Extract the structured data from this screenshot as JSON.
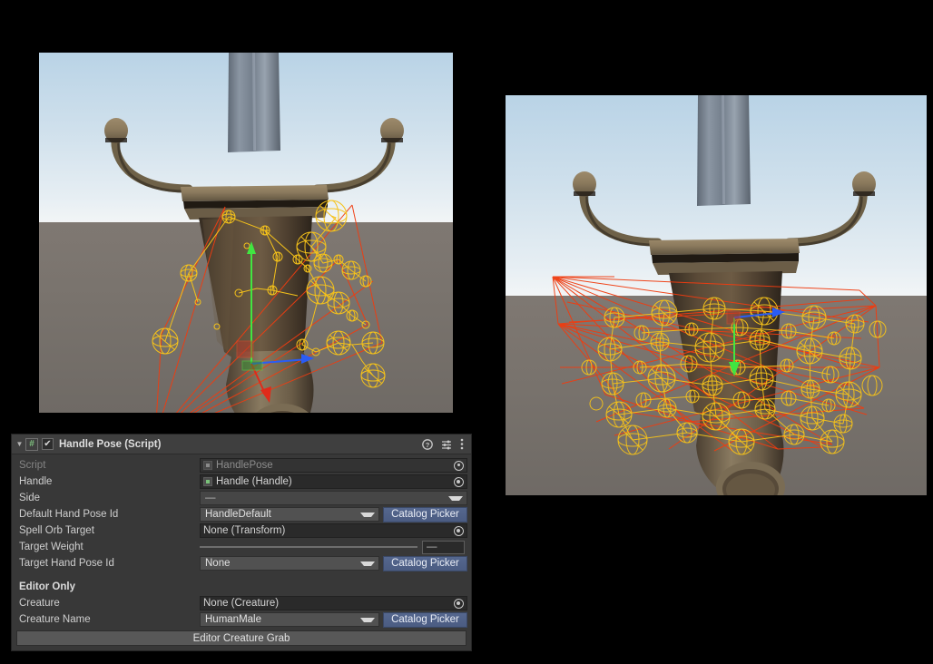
{
  "app": {
    "editor": "Unity Editor",
    "background_color": "#000000"
  },
  "viewports": [
    {
      "name": "scene-view-left",
      "description": "3D scene view of a sword handle with yellow wireframe hand-pose gizmo spheres and red selection lines",
      "sky_color": "#cfe0ec",
      "ground_color": "#79736d",
      "gizmo_colors": {
        "pose_sphere": "#f5c21a",
        "selection_line": "#f03c10",
        "axis_y": "#41e541",
        "axis_x": "#2a5cf5",
        "axis_z": "#e02a1a"
      }
    },
    {
      "name": "scene-view-right",
      "description": "3D scene view of the same sword handle with a dense cluster of yellow hand-pose wireframe spheres",
      "sky_color": "#cfe0ec",
      "ground_color": "#79736d",
      "gizmo_colors": {
        "pose_sphere": "#f5c21a",
        "selection_line": "#f03c10",
        "axis_y": "#41e541"
      }
    }
  ],
  "inspector": {
    "header": {
      "title": "Handle Pose (Script)",
      "foldout_glyph": "▼",
      "script_icon": "#",
      "enabled_checkbox": "✔",
      "help_icon": "help-icon",
      "preset_icon": "preset-icon",
      "menu_icon": "kebab-menu-icon"
    },
    "accent_colors": {
      "button_blue": "#4b5c82",
      "panel_bg": "#383838",
      "field_bg": "#2a2a2a",
      "dropdown_bg": "#515151"
    },
    "rows": [
      {
        "label": "Script",
        "type": "object",
        "value": "HandlePose",
        "disabled": true,
        "has_icon": true,
        "has_target": true
      },
      {
        "label": "Handle",
        "type": "object",
        "value": "Handle (Handle)",
        "disabled": false,
        "has_icon": true,
        "has_target": true
      },
      {
        "label": "Side",
        "type": "dropdown",
        "value": "—",
        "flat": true
      },
      {
        "label": "Default Hand Pose Id",
        "type": "dropdown-button",
        "value": "HandleDefault",
        "button": "Catalog Picker"
      },
      {
        "label": "Spell Orb Target",
        "type": "object",
        "value": "None (Transform)",
        "disabled": false,
        "has_icon": false,
        "has_target": true
      },
      {
        "label": "Target Weight",
        "type": "slider",
        "value": "—",
        "slider_fill": 0
      },
      {
        "label": "Target Hand Pose Id",
        "type": "dropdown-button",
        "value": "None",
        "button": "Catalog Picker"
      },
      {
        "label": "Editor Only",
        "type": "section-header"
      },
      {
        "label": "Creature",
        "type": "object",
        "value": "None (Creature)",
        "disabled": false,
        "has_icon": false,
        "has_target": true
      },
      {
        "label": "Creature Name",
        "type": "dropdown-button",
        "value": "HumanMale",
        "button": "Catalog Picker"
      }
    ],
    "action_button": "Editor Creature Grab"
  }
}
